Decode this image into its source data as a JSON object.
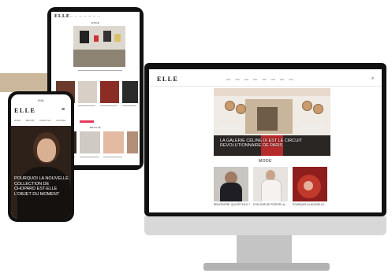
{
  "tablet": {
    "logo": "ELLE",
    "section_top": "MODE",
    "section_mid": "BEAUTÉ"
  },
  "monitor": {
    "logo": "ELLE",
    "hero_title": "LA GALERIE CÉLINE IX EST LE CIRCUIT REVOLUTIONNAIRE DE PARIS",
    "section_label": "MODE",
    "cards": [
      {
        "caption": "RENCONTRE, QUI EST-ELLE ?"
      },
      {
        "caption": "5 FACONS DE PORTER LA..."
      },
      {
        "caption": "POURQUOI LA NOUVELLE..."
      }
    ]
  },
  "phone": {
    "time": "9:41",
    "logo": "ELLE",
    "nav": [
      "MODE",
      "BEAUTÉ",
      "LIFESTYLE",
      "CULTURE"
    ],
    "hero_title": "POURQUOI LA NOUVELLE COLLECTION DE CHOPARD EST-ELLE L'OBJET DU MOMENT"
  },
  "colors": {
    "accent_band": "#cbb89c",
    "carpet_red": "#b52a2a",
    "badge_pink": "#e23c5b"
  },
  "icons": [
    "search-icon",
    "menu-icon"
  ]
}
